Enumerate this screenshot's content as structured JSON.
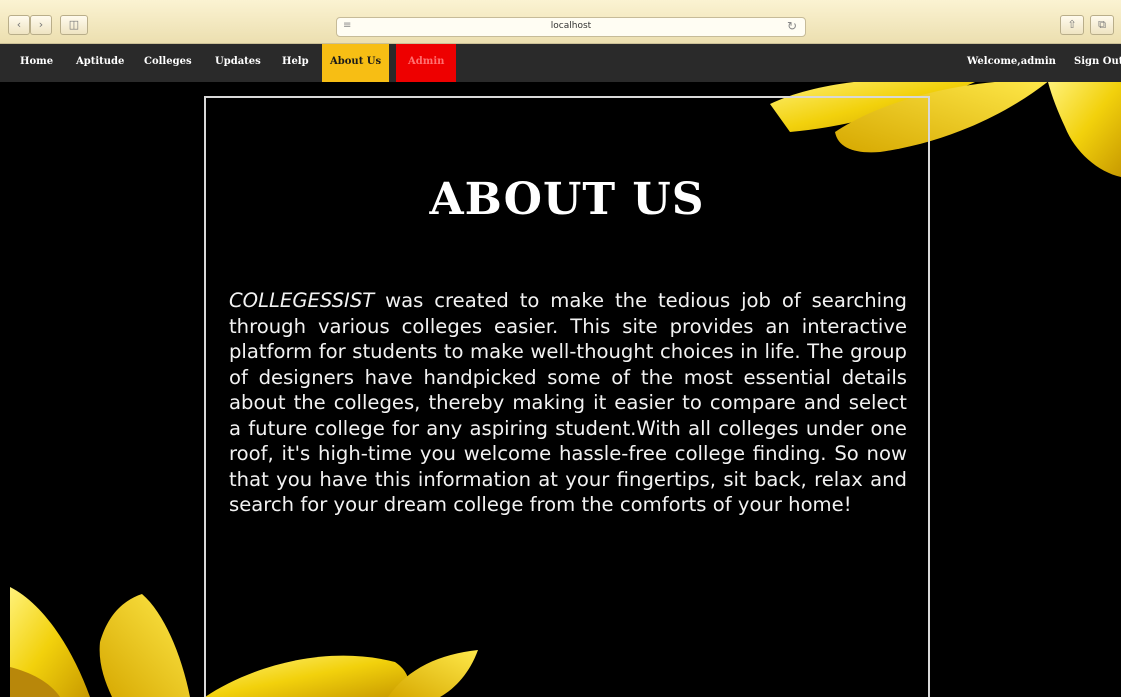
{
  "browser": {
    "url": "localhost",
    "colors": {
      "chrome_bg": "#efe3b8",
      "nav_bg": "#2a2a2a",
      "about_bg": "#f7be14",
      "admin_bg": "#ee0000",
      "petal": "#f2d10c"
    }
  },
  "nav": {
    "items": [
      {
        "label": "Home"
      },
      {
        "label": "Aptitude"
      },
      {
        "label": "Colleges"
      },
      {
        "label": "Updates"
      },
      {
        "label": "Help"
      },
      {
        "label": "About Us"
      },
      {
        "label": "Admin"
      }
    ],
    "welcome": "Welcome,admin",
    "sign_out": "Sign Out"
  },
  "page": {
    "title": "ABOUT US",
    "brand": "COLLEGESSIST",
    "body": " was created to make the tedious job of searching through various colleges easier. This site provides an interactive platform for students to make well-thought choices in life. The group of designers have handpicked some of the most essential details about the colleges, thereby making it easier to compare and select a future college for any aspiring student.With all colleges under one roof, it's high-time you welcome hassle-free college finding. So now that you have this information at your fingertips, sit back, relax and search for your dream college from the comforts of your home!"
  }
}
